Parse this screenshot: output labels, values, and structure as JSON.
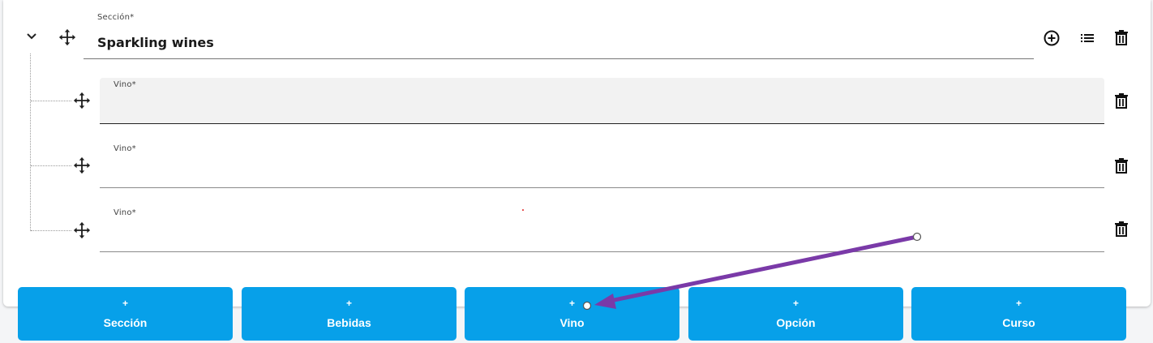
{
  "section": {
    "label": "Sección*",
    "value": "Sparkling wines",
    "icons": [
      "chevron-down-icon",
      "move-icon",
      "add-circle-icon",
      "list-icon",
      "trash-icon"
    ]
  },
  "wines": [
    {
      "label": "Vino*",
      "value": ""
    },
    {
      "label": "Vino*",
      "value": ""
    },
    {
      "label": "Vino*",
      "value": ""
    }
  ],
  "buttons": [
    {
      "plus": "+",
      "label": "Sección"
    },
    {
      "plus": "+",
      "label": "Bebidas"
    },
    {
      "plus": "+",
      "label": "Vino"
    },
    {
      "plus": "+",
      "label": "Opción"
    },
    {
      "plus": "+",
      "label": "Curso"
    }
  ],
  "colors": {
    "button": "#07a0e9",
    "annotation_arrow": "#7a3aa8"
  }
}
